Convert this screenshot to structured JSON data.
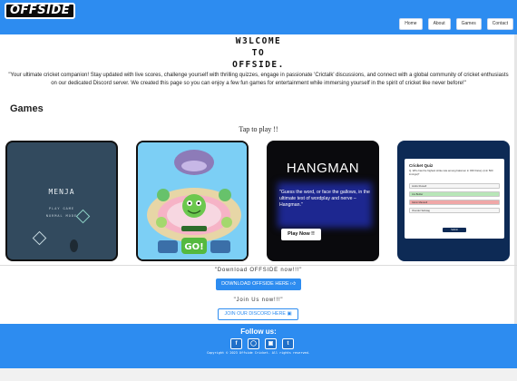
{
  "header": {
    "logo": "OFFSIDE",
    "nav": [
      "Home",
      "About",
      "Games",
      "Contact"
    ]
  },
  "welcome": {
    "line1": "W3LCOME",
    "line2": "TO",
    "line3": "OFFSIDE."
  },
  "intro": "\"Your ultimate cricket companion! Stay updated with live scores, challenge yourself with thrilling quizzes, engage in passionate 'Crictalk' discussions, and connect with a global community of cricket enthusiasts on our dedicated Discord server. We created this page so you can enjoy a few fun games for entertainment while immersing yourself in the spirit of cricket like never before!\"",
  "games": {
    "title": "Games",
    "tap_hint": "Tap to play !!",
    "menja": {
      "title": "MENJA",
      "play": "PLAY GAME",
      "mode": "NORMAL MODE"
    },
    "omnom": {
      "go": "GO!"
    },
    "hangman": {
      "title": "HANGMAN",
      "description": "\"Guess the word, or face the gallows, in the ultimate test of wordplay and nerve – Hangman.\"",
      "button": "Play Now !!"
    },
    "quiz": {
      "title": "Cricket Quiz",
      "question": "Q. Who has the highest strike rate among batsmen in ODI history (min 500 innings)?",
      "options": [
        "Andre Russell",
        "Jos Buttler",
        "Glenn Maxwell",
        "Virender Sehwag"
      ],
      "submit": "Submit"
    }
  },
  "download": {
    "text": "\"Download OFFSIDE now!!!\"",
    "button": "DOWNLOAD OFFSIDE HERE"
  },
  "join": {
    "text": "\"Join Us now!!!\"",
    "button": "JOIN OUR DISCORD HERE"
  },
  "footer": {
    "follow": "Follow us:",
    "socials": [
      "facebook-icon",
      "instagram-icon",
      "discord-icon",
      "twitter-icon"
    ],
    "copyright": "Copyright © 2023 Offside Cricket. All rights reserved."
  },
  "colors": {
    "primary": "#2d8cf0",
    "dark": "#0a0a0d"
  }
}
